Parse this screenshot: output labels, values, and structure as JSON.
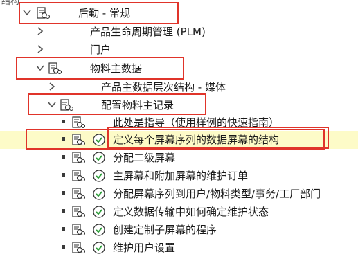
{
  "tree": {
    "top_partial_label": "结构",
    "nodes": [
      {
        "label": "后勤 - 常规"
      },
      {
        "label": "产品生命周期管理 (PLM)"
      },
      {
        "label": "门户"
      },
      {
        "label": "物料主数据"
      },
      {
        "label": "产品主数据层次结构 - 媒体"
      },
      {
        "label": "配置物料主记录"
      },
      {
        "label": "此处是指导（使用样例的快速指南）"
      },
      {
        "label": "定义每个屏幕序列的数据屏幕的结构"
      },
      {
        "label": "分配二级屏幕"
      },
      {
        "label": "主屏幕和附加屏幕的维护订单"
      },
      {
        "label": "分配屏幕序列到用户/物料类型/事务/工厂部门"
      },
      {
        "label": "定义数据传输中如何确定维护状态"
      },
      {
        "label": "创建定制子屏幕的程序"
      },
      {
        "label": "维护用户设置"
      }
    ]
  },
  "colors": {
    "highlight_row": "#fdfbc8",
    "annotation_box": "#e0342a",
    "execute_icon_check": "#2e9e3a"
  }
}
